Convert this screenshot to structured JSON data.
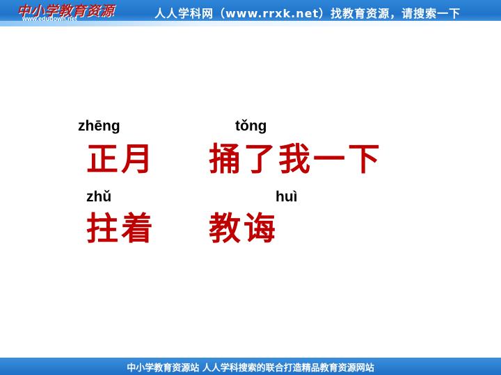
{
  "header": {
    "logo_title": "中小学教育资源",
    "logo_url": "www.edudown.net",
    "banner_text": "人人学科网（www.rrxk.net）找教育资源，请搜索一下"
  },
  "content": {
    "items": [
      {
        "pinyin": "zhēng",
        "hanzi": "正月"
      },
      {
        "pinyin": "tǒng",
        "hanzi": "捅了我一下"
      },
      {
        "pinyin": "zhǔ",
        "hanzi": "拄着"
      },
      {
        "pinyin": "huì",
        "hanzi": "教诲"
      }
    ]
  },
  "footer": {
    "text": "中小学教育资源站  人人学科搜索的联合打造精品教育资源网站"
  },
  "colors": {
    "banner": "#1f73c9",
    "hanzi": "#c00000",
    "pinyin": "#000000"
  }
}
